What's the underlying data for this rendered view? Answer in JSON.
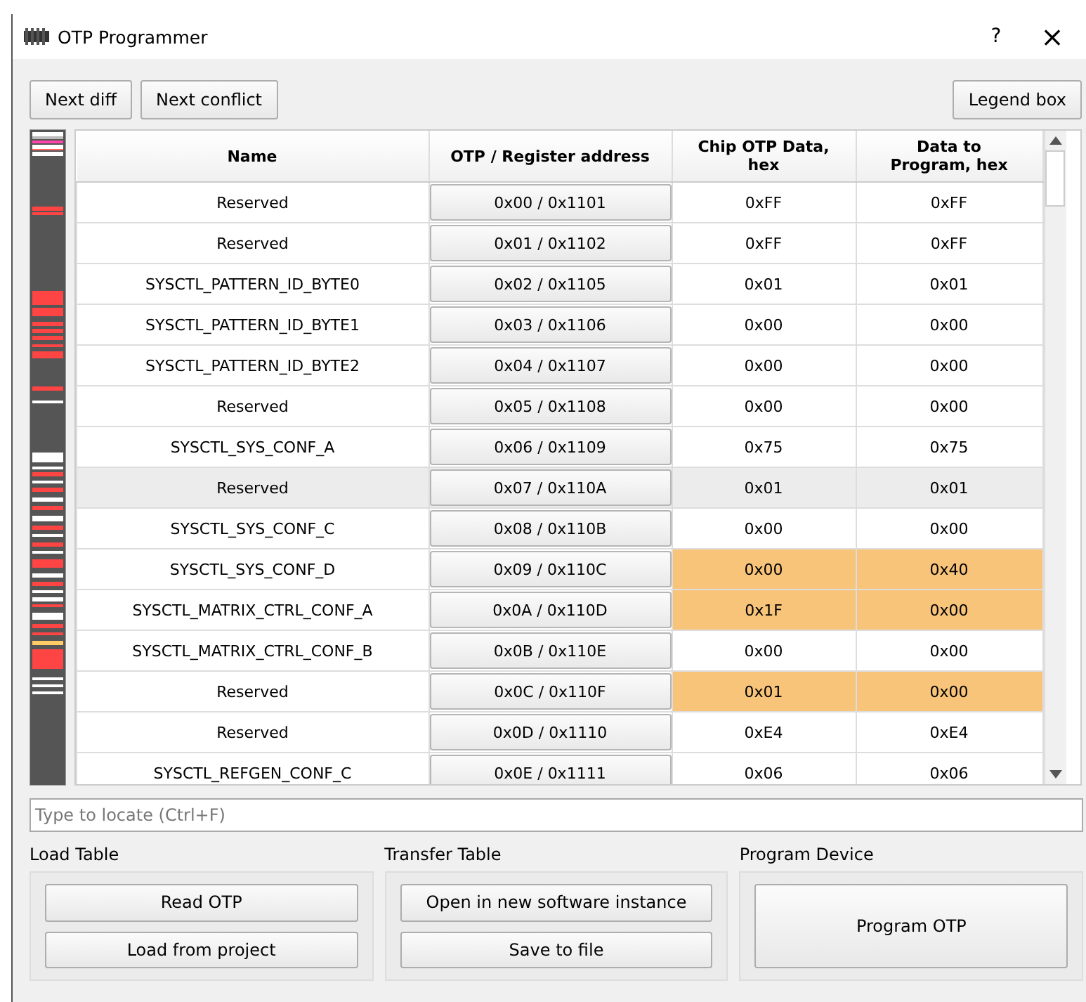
{
  "window": {
    "title": "OTP Programmer",
    "help": "?",
    "close": "×"
  },
  "toolbar": {
    "left_buttons": [
      "Next diff",
      "Next conflict"
    ],
    "right_button": "Legend box"
  },
  "table": {
    "columns": [
      "Name",
      "OTP / Register address",
      "Chip OTP Data, hex",
      "Data to Program, hex"
    ],
    "rows": [
      {
        "name": "Reserved",
        "address": "0x00 / 0x1101",
        "chip": "0xFF",
        "program": "0xFF",
        "diff": false,
        "selected": false
      },
      {
        "name": "Reserved",
        "address": "0x01 / 0x1102",
        "chip": "0xFF",
        "program": "0xFF",
        "diff": false,
        "selected": false
      },
      {
        "name": "SYSCTL_PATTERN_ID_BYTE0",
        "address": "0x02 / 0x1105",
        "chip": "0x01",
        "program": "0x01",
        "diff": false,
        "selected": false
      },
      {
        "name": "SYSCTL_PATTERN_ID_BYTE1",
        "address": "0x03 / 0x1106",
        "chip": "0x00",
        "program": "0x00",
        "diff": false,
        "selected": false
      },
      {
        "name": "SYSCTL_PATTERN_ID_BYTE2",
        "address": "0x04 / 0x1107",
        "chip": "0x00",
        "program": "0x00",
        "diff": false,
        "selected": false
      },
      {
        "name": "Reserved",
        "address": "0x05 / 0x1108",
        "chip": "0x00",
        "program": "0x00",
        "diff": false,
        "selected": false
      },
      {
        "name": "SYSCTL_SYS_CONF_A",
        "address": "0x06 / 0x1109",
        "chip": "0x75",
        "program": "0x75",
        "diff": false,
        "selected": false
      },
      {
        "name": "Reserved",
        "address": "0x07 / 0x110A",
        "chip": "0x01",
        "program": "0x01",
        "diff": false,
        "selected": true
      },
      {
        "name": "SYSCTL_SYS_CONF_C",
        "address": "0x08 / 0x110B",
        "chip": "0x00",
        "program": "0x00",
        "diff": false,
        "selected": false
      },
      {
        "name": "SYSCTL_SYS_CONF_D",
        "address": "0x09 / 0x110C",
        "chip": "0x00",
        "program": "0x40",
        "diff": true,
        "selected": false
      },
      {
        "name": "SYSCTL_MATRIX_CTRL_CONF_A",
        "address": "0x0A / 0x110D",
        "chip": "0x1F",
        "program": "0x00",
        "diff": true,
        "selected": false
      },
      {
        "name": "SYSCTL_MATRIX_CTRL_CONF_B",
        "address": "0x0B / 0x110E",
        "chip": "0x00",
        "program": "0x00",
        "diff": false,
        "selected": false
      },
      {
        "name": "Reserved",
        "address": "0x0C / 0x110F",
        "chip": "0x01",
        "program": "0x00",
        "diff": true,
        "selected": false
      },
      {
        "name": "Reserved",
        "address": "0x0D / 0x1110",
        "chip": "0xE4",
        "program": "0xE4",
        "diff": false,
        "selected": false
      },
      {
        "name": "SYSCTL_REFGEN_CONF_C",
        "address": "0x0E / 0x1111",
        "chip": "0x06",
        "program": "0x06",
        "diff": false,
        "selected": false
      }
    ]
  },
  "search": {
    "placeholder": "Type to locate (Ctrl+F)"
  },
  "groups": [
    {
      "title": "Load Table",
      "buttons": [
        "Read OTP",
        "Load from project"
      ]
    },
    {
      "title": "Transfer Table",
      "buttons": [
        "Open in new software instance",
        "Save to file"
      ]
    },
    {
      "title": "Program Device",
      "buttons": [
        "Program OTP"
      ]
    }
  ]
}
